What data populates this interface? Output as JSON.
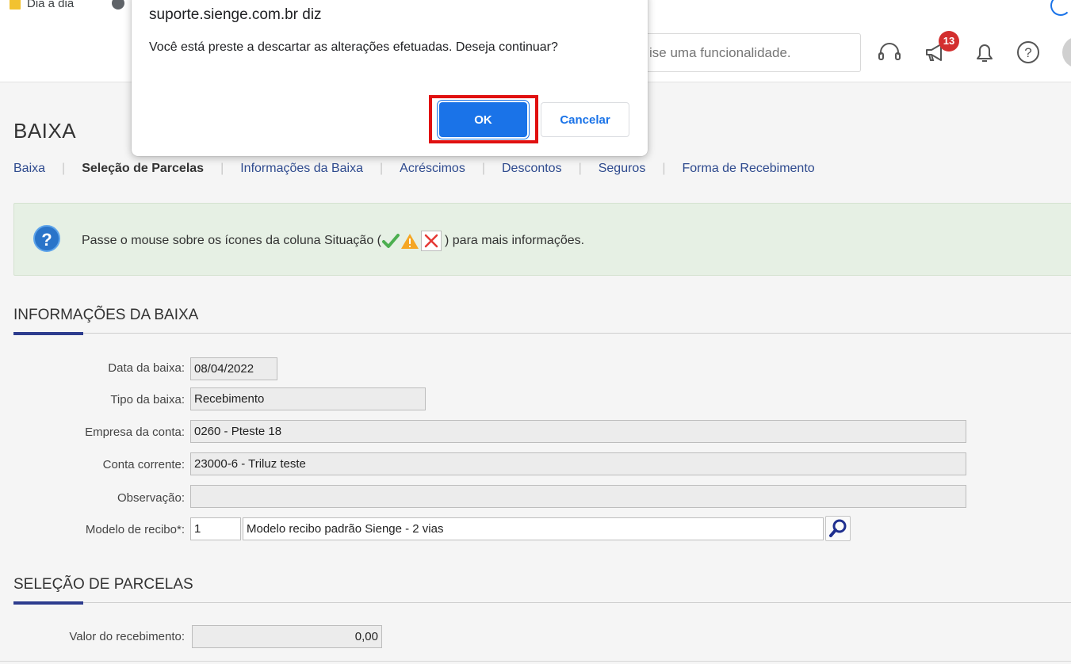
{
  "browser": {
    "bookmark_label": "Dia a dia"
  },
  "header": {
    "search_placeholder": "ise uma funcionalidade.",
    "notification_count": "13"
  },
  "page": {
    "title": "BAIXA",
    "tabs": [
      {
        "label": "Baixa",
        "active": false
      },
      {
        "label": "Seleção de Parcelas",
        "active": true
      },
      {
        "label": "Informações da Baixa",
        "active": false
      },
      {
        "label": "Acréscimos",
        "active": false
      },
      {
        "label": "Descontos",
        "active": false
      },
      {
        "label": "Seguros",
        "active": false
      },
      {
        "label": "Forma de Recebimento",
        "active": false
      }
    ],
    "tab_separator": "|",
    "info": {
      "text_before": "Passe o mouse sobre os ícones da coluna Situação (",
      "text_after": ") para mais informações."
    }
  },
  "informacoes_baixa": {
    "title": "INFORMAÇÕES DA BAIXA",
    "fields": {
      "data_label": "Data da baixa:",
      "data_value": "08/04/2022",
      "tipo_label": "Tipo da baixa:",
      "tipo_value": "Recebimento",
      "empresa_label": "Empresa da conta:",
      "empresa_value": "0260 - Pteste 18",
      "conta_label": "Conta corrente:",
      "conta_value": "23000-6 - Triluz teste",
      "obs_label": "Observação:",
      "obs_value": "",
      "modelo_label": "Modelo de recibo*:",
      "modelo_code": "1",
      "modelo_desc": "Modelo recibo padrão Sienge - 2 vias"
    }
  },
  "selecao_parcelas": {
    "title": "SELEÇÃO DE PARCELAS",
    "valor_label": "Valor do recebimento:",
    "valor_value": "0,00"
  },
  "dialog": {
    "origin": "suporte.sienge.com.br diz",
    "message": "Você está preste a descartar as alterações efetuadas. Deseja continuar?",
    "ok_label": "OK",
    "cancel_label": "Cancelar"
  },
  "colors": {
    "primary_blue": "#1a73e8",
    "highlight_red": "#e01010",
    "section_accent": "#2d3c8e",
    "info_bg": "#e6f0e4",
    "badge_red": "#d32f2f"
  }
}
